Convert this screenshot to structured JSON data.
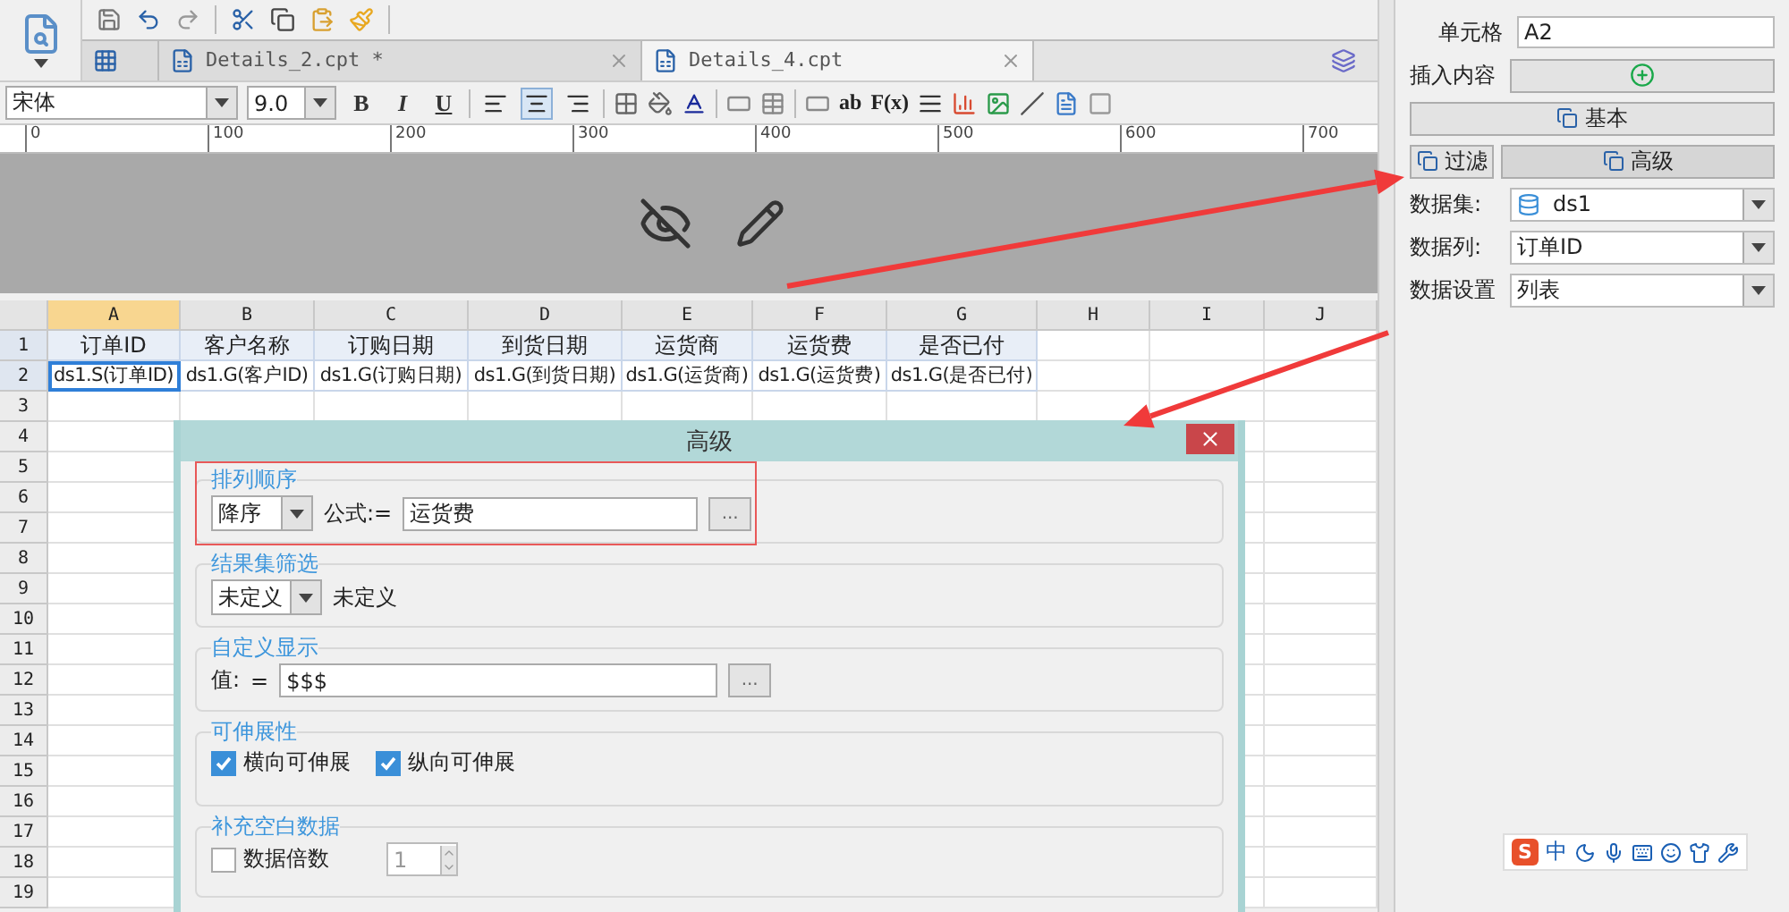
{
  "toolbar": {
    "tabs": [
      {
        "label": "Details_2.cpt *",
        "selected": false
      },
      {
        "label": "Details_4.cpt",
        "selected": true
      }
    ]
  },
  "format_bar": {
    "font": "宋体",
    "size": "9.0",
    "styles": [
      "B",
      "I",
      "U"
    ],
    "alignments": [
      {
        "selected": false
      },
      {
        "selected": true
      },
      {
        "selected": false
      }
    ],
    "insert_tools": [
      "ab",
      "F(x)"
    ]
  },
  "ruler": [
    "0",
    "100",
    "200",
    "300",
    "400",
    "500",
    "600",
    "700"
  ],
  "sheet": {
    "columns": [
      {
        "label": "A",
        "selected": true
      },
      {
        "label": "B",
        "selected": false
      },
      {
        "label": "C",
        "selected": false
      },
      {
        "label": "D",
        "selected": false
      },
      {
        "label": "E",
        "selected": false
      },
      {
        "label": "F",
        "selected": false
      },
      {
        "label": "G",
        "selected": false
      },
      {
        "label": "H",
        "selected": false
      },
      {
        "label": "I",
        "selected": false
      },
      {
        "label": "J",
        "selected": false
      }
    ],
    "rows": [
      {
        "label": "1",
        "cells": [
          {
            "text": "订单ID",
            "selected": false
          },
          {
            "text": "客户名称",
            "selected": false
          },
          {
            "text": "订购日期",
            "selected": false
          },
          {
            "text": "到货日期",
            "selected": false
          },
          {
            "text": "运货商",
            "selected": false
          },
          {
            "text": "运货费",
            "selected": false
          },
          {
            "text": "是否已付",
            "selected": false
          }
        ]
      },
      {
        "label": "2",
        "cells": [
          {
            "text": "ds1.S(订单ID)",
            "selected": true
          },
          {
            "text": "ds1.G(客户ID)",
            "selected": false
          },
          {
            "text": "ds1.G(订购日期)",
            "selected": false
          },
          {
            "text": "ds1.G(到货日期)",
            "selected": false
          },
          {
            "text": "ds1.G(运货商)",
            "selected": false
          },
          {
            "text": "ds1.G(运货费)",
            "selected": false
          },
          {
            "text": "ds1.G(是否已付)",
            "selected": false
          }
        ]
      },
      {
        "label": "3"
      },
      {
        "label": "4"
      },
      {
        "label": "5"
      },
      {
        "label": "6"
      },
      {
        "label": "7"
      },
      {
        "label": "8"
      },
      {
        "label": "9"
      },
      {
        "label": "10"
      },
      {
        "label": "11"
      },
      {
        "label": "12"
      },
      {
        "label": "13"
      },
      {
        "label": "14"
      },
      {
        "label": "15"
      },
      {
        "label": "16"
      },
      {
        "label": "17"
      },
      {
        "label": "18"
      },
      {
        "label": "19"
      }
    ]
  },
  "dialog": {
    "title": "高级",
    "sections": [
      {
        "kind": "sort",
        "legend": "排列顺序",
        "order": "降序",
        "formula_label": "公式:=",
        "formula": "运货费",
        "more": "...",
        "highlighted": true
      },
      {
        "kind": "filter",
        "legend": "结果集筛选",
        "mode": "未定义",
        "summary": "未定义"
      },
      {
        "kind": "display",
        "legend": "自定义显示",
        "value_label": "值:",
        "equals": "=",
        "value": "$$$",
        "more": "..."
      },
      {
        "kind": "expand",
        "legend": "可伸展性",
        "options": [
          {
            "label": "横向可伸展",
            "checked": true
          },
          {
            "label": "纵向可伸展",
            "checked": true
          }
        ]
      },
      {
        "kind": "fill",
        "legend": "补充空白数据",
        "options": [
          {
            "label": "数据倍数",
            "checked": false
          }
        ],
        "multiple": "1"
      }
    ]
  },
  "panel": {
    "cell_label": "单元格",
    "cell": "A2",
    "insert_label": "插入内容",
    "tabs": [
      {
        "label": "基本",
        "selected": false
      },
      {
        "label": "过滤",
        "selected": false
      },
      {
        "label": "高级",
        "selected": true
      }
    ],
    "fields": [
      {
        "label": "数据集:",
        "value": "ds1",
        "kind": "dataset"
      },
      {
        "label": "数据列:",
        "value": "订单ID",
        "kind": "plain"
      },
      {
        "label": "数据设置",
        "value": "列表",
        "kind": "plain"
      }
    ]
  },
  "ime": {
    "logo": "S",
    "mode": "中"
  }
}
